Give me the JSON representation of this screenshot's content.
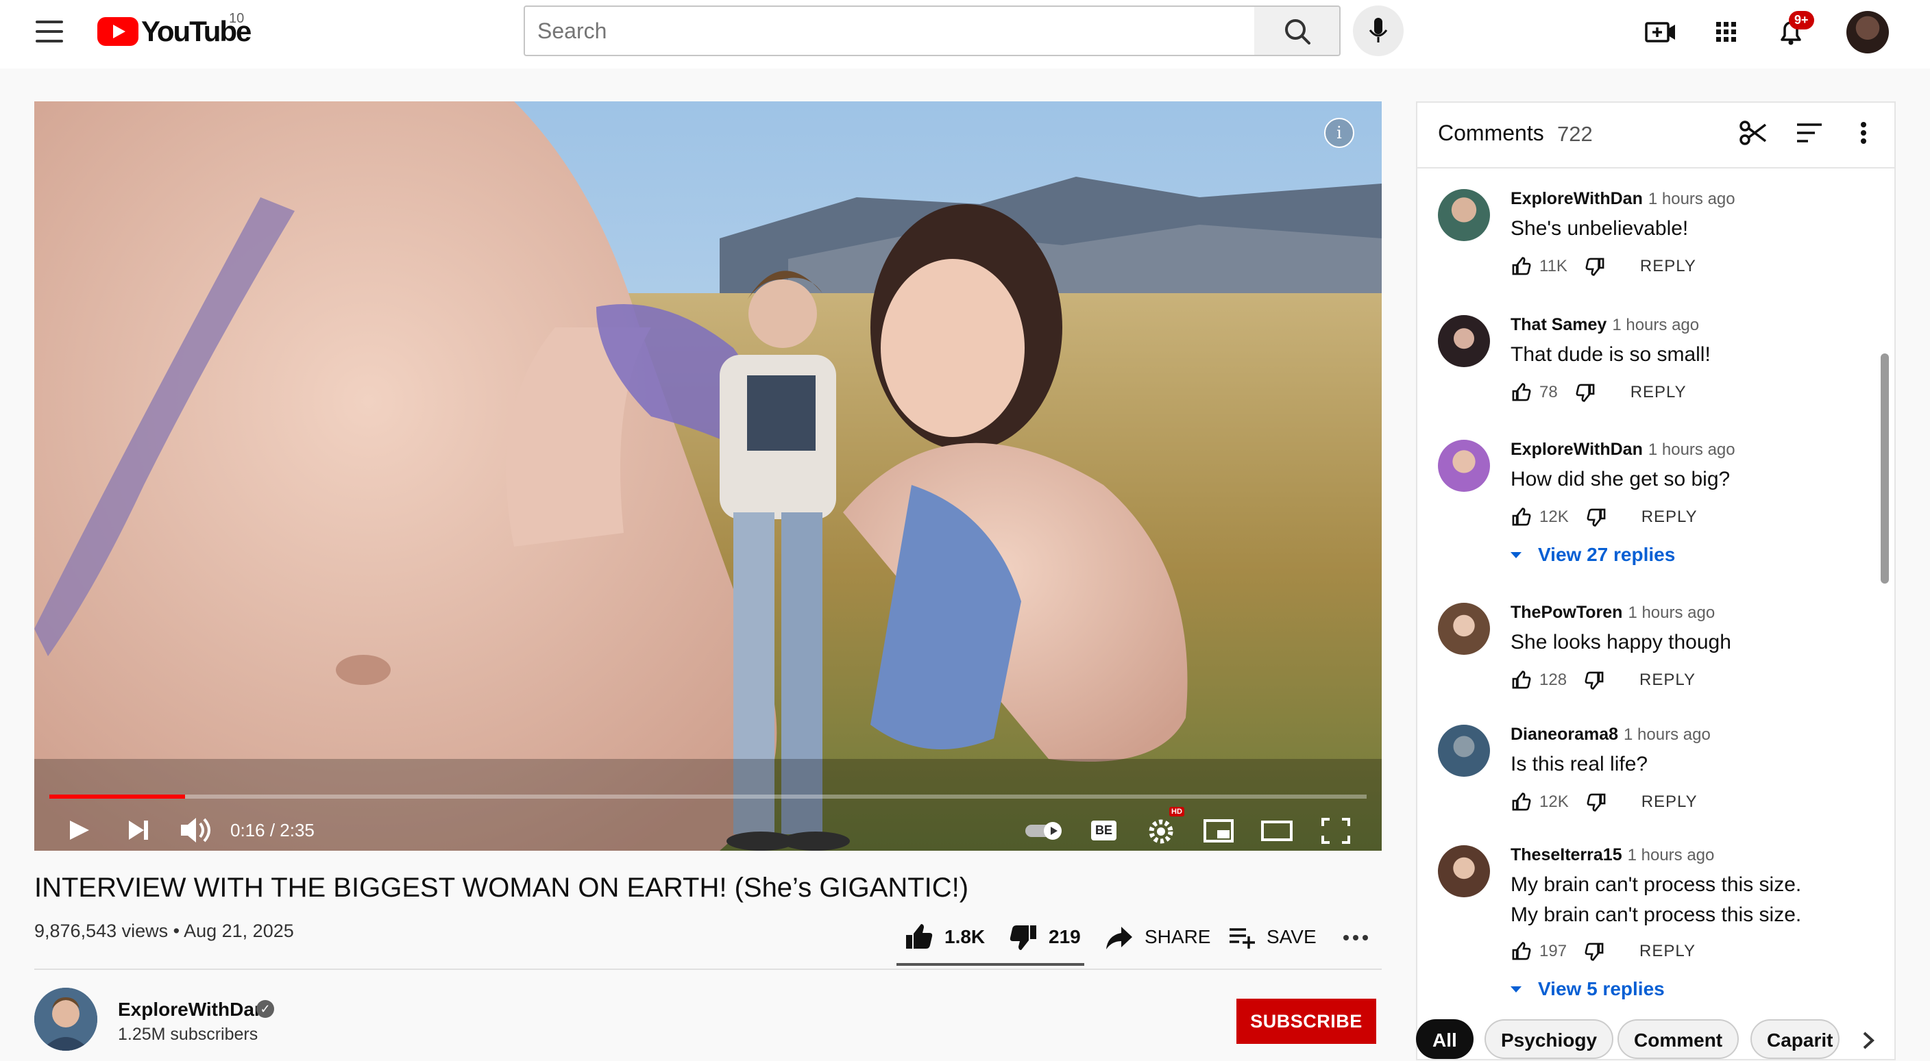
{
  "header": {
    "logo_text": "YouTube",
    "country_code": "10",
    "search_placeholder": "Search",
    "notification_count": "9+"
  },
  "video": {
    "current_time": "0:16",
    "duration": "2:35",
    "time_display": "0:16 / 2:35",
    "progress_fraction": 0.103,
    "cc_label": "BE",
    "hd_badge": "HD",
    "info_label": "i"
  },
  "details": {
    "title": "INTERVIEW WITH THE BIGGEST WOMAN ON EARTH! (She’s GIGANTIC!)",
    "views_date": "9,876,543 views • Aug 21, 2025",
    "likes": "1.8K",
    "dislikes": "219",
    "share_label": "SHARE",
    "save_label": "SAVE"
  },
  "channel": {
    "name": "ExploreWithDan",
    "subscribers": "1.25M subscribers",
    "subscribe_label": "SUBSCRIBE",
    "verified_mark": "✓"
  },
  "comments": {
    "title": "Comments",
    "count": "722",
    "items": [
      {
        "author": "ExploreWithDan",
        "time": "1 hours ago",
        "text": "She's unbelievable!",
        "likes": "11K",
        "reply": "REPLY"
      },
      {
        "author": "That Samey",
        "time": "1 hours ago",
        "text": "That dude is so small!",
        "likes": "78",
        "reply": "REPLY"
      },
      {
        "author": "ExploreWithDan",
        "time": "1 hours ago",
        "text": "How did she get so big?",
        "likes": "12K",
        "reply": "REPLY",
        "view_replies": "View 27 replies"
      },
      {
        "author": "ThePowToren",
        "time": "1 hours ago",
        "text": "She looks happy though",
        "likes": "128",
        "reply": "REPLY"
      },
      {
        "author": "Dianeorama8",
        "time": "1 hours ago",
        "text": "Is this real life?",
        "likes": "12K",
        "reply": "REPLY"
      },
      {
        "author": "TheseIterra15",
        "time": "1 hours ago",
        "text": "My brain can't process this size.",
        "text2": "My brain can't process this size.",
        "likes": "197",
        "reply": "REPLY",
        "view_replies": "View 5 replies"
      }
    ]
  },
  "chips": [
    "All",
    "Psychiogy",
    "Comment",
    "Caparit"
  ],
  "colors": {
    "brand_red": "#ff0000",
    "subscribe_red": "#cc0000",
    "link_blue": "#065fd4"
  }
}
